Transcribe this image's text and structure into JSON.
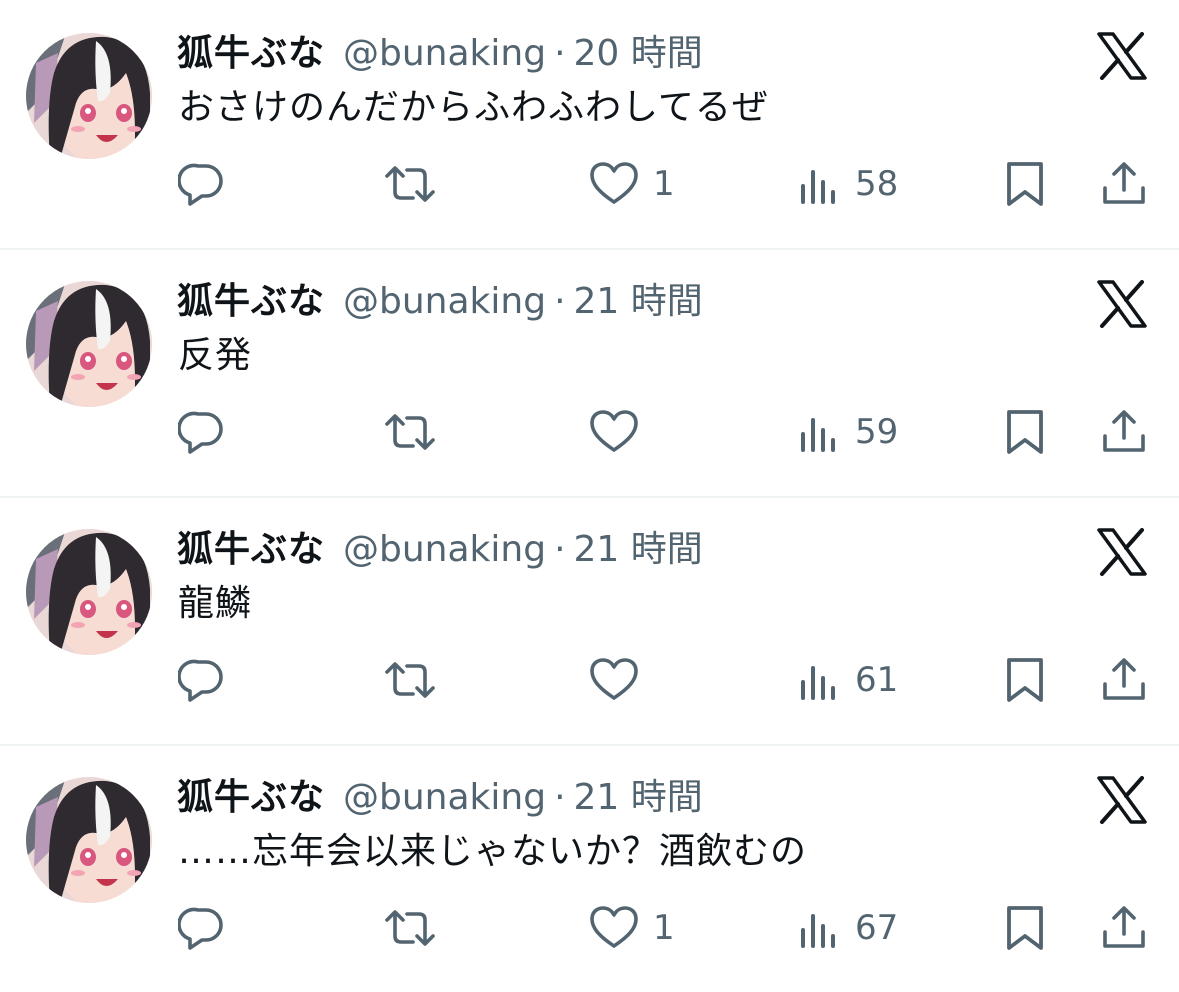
{
  "tweets": [
    {
      "name": "狐牛ぶな",
      "handle": "@bunaking",
      "separator": "·",
      "time": "20 時間",
      "text": "おさけのんだからふわふわしてるぜ",
      "likes": "1",
      "views": "58"
    },
    {
      "name": "狐牛ぶな",
      "handle": "@bunaking",
      "separator": "·",
      "time": "21 時間",
      "text": "反発",
      "likes": "",
      "views": "59"
    },
    {
      "name": "狐牛ぶな",
      "handle": "@bunaking",
      "separator": "·",
      "time": "21 時間",
      "text": "龍鱗",
      "likes": "",
      "views": "61"
    },
    {
      "name": "狐牛ぶな",
      "handle": "@bunaking",
      "separator": "·",
      "time": "21 時間",
      "text": "……忘年会以来じゃないか？酒飲むの",
      "likes": "1",
      "views": "67"
    }
  ],
  "icons": {
    "brand": "x-logo-icon",
    "reply": "reply-icon",
    "retweet": "retweet-icon",
    "like": "heart-icon",
    "views": "views-icon",
    "bookmark": "bookmark-icon",
    "share": "share-icon"
  },
  "colors": {
    "text_primary": "#0f1419",
    "text_secondary": "#536471",
    "divider": "#eff3f4"
  }
}
